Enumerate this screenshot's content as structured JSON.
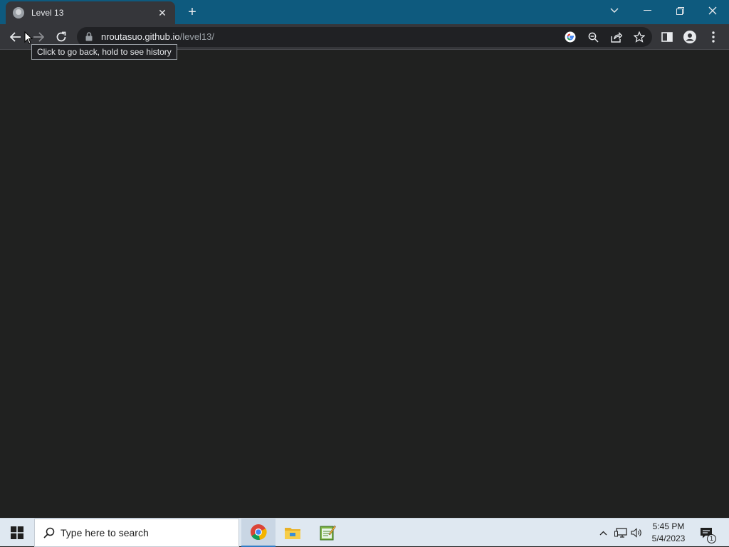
{
  "browser": {
    "tab": {
      "title": "Level 13",
      "favicon": "globe-favicon-icon",
      "close": "✕"
    },
    "new_tab": "+",
    "window_controls": {
      "tab_search": "chevron-down-icon",
      "minimize": "—",
      "restore": "restore-icon",
      "close": "✕"
    },
    "address": {
      "host": "nroutasuo.github.io",
      "path": "/level13/"
    },
    "tooltip": "Click to go back, hold to see history"
  },
  "taskbar": {
    "search_placeholder": "Type here to search",
    "apps": [
      "chrome-icon",
      "file-explorer-icon",
      "notepad-icon"
    ],
    "clock": {
      "time": "5:45 PM",
      "date": "5/4/2023"
    },
    "notifications_count": "1"
  },
  "colors": {
    "titlebar": "#0e5a7e",
    "toolbar": "#35363a",
    "page_bg": "#202120",
    "taskbar": "#dfe8f1"
  }
}
